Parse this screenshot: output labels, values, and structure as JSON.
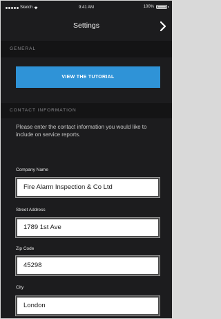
{
  "status_bar": {
    "carrier": "Sketch",
    "time": "9:41 AM",
    "battery": "100%"
  },
  "nav": {
    "title": "Settings"
  },
  "sections": {
    "general_header": "GENERAL",
    "tutorial_button": "VIEW THE TUTORIAL",
    "contact_header": "CONTACT INFORMATION",
    "intro": "Please enter the contact information you would like to include on service reports."
  },
  "fields": {
    "company_name": {
      "label": "Company Name",
      "value": "Fire Alarm Inspection & Co Ltd"
    },
    "street_address": {
      "label": "Street Address",
      "value": "1789 1st Ave"
    },
    "zip_code": {
      "label": "Zip Code",
      "value": "45298"
    },
    "city": {
      "label": "City",
      "value": "London"
    }
  },
  "colors": {
    "background": "#1c1c1e",
    "section_header_bg": "#141415",
    "accent_button": "#2f93d7"
  }
}
